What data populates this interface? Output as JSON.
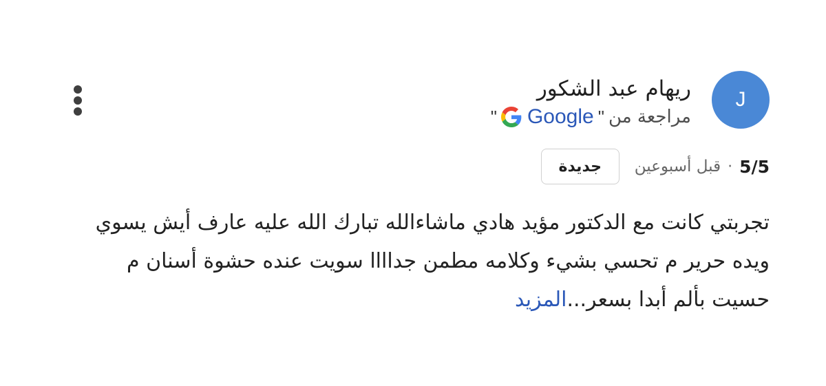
{
  "review": {
    "avatar_initial": "J",
    "author_name": "ريهام عبد الشكور",
    "source_prefix": "مراجعة من",
    "source_quote_open": "\"",
    "source_quote_close": "\"",
    "source_name": "Google",
    "source_icon": "google-g-icon",
    "rating": "5/5",
    "separator": "·",
    "time_ago": "قبل أسبوعين",
    "badge_label": "جديدة",
    "text": "تجربتي كانت مع الدكتور مؤيد هادي ماشاءالله تبارك الله عليه عارف أيش يسوي ويده حرير م تحسي بشيء وكلامه مطمن جداااا سويت عنده حشوة أسنان م حسيت بألم أبدا بسعر...",
    "read_more_label": "المزيد",
    "menu_icon": "more-vert-icon"
  },
  "colors": {
    "avatar_bg": "#4a88d6",
    "link": "#2b58b8",
    "google_blue": "#4285F4",
    "google_red": "#EA4335",
    "google_yellow": "#FBBC05",
    "google_green": "#34A853"
  }
}
